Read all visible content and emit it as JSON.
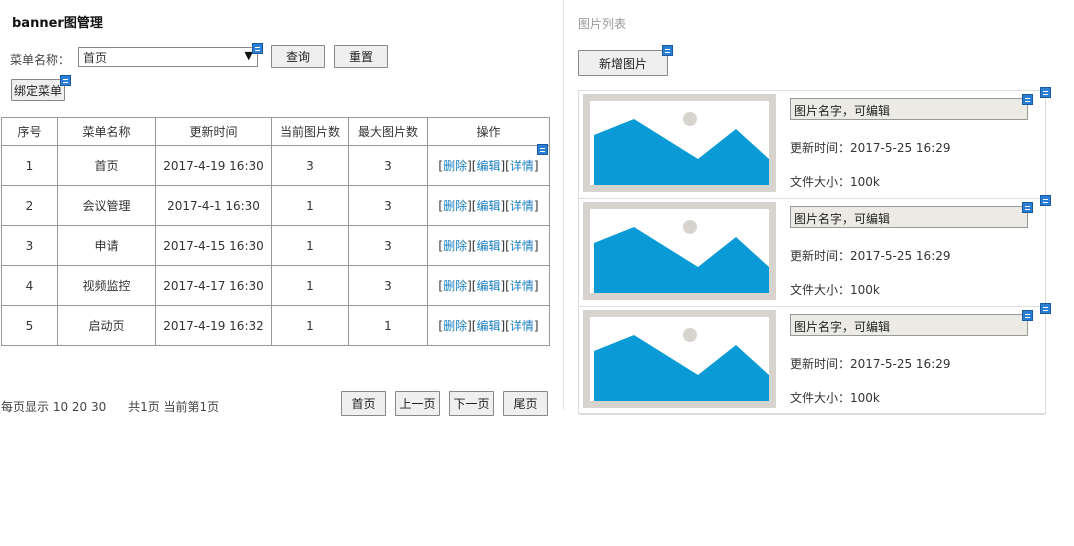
{
  "page_title": "banner图管理",
  "filter": {
    "label": "菜单名称：",
    "selected": "首页",
    "query_button": "查询",
    "reset_button": "重置",
    "bind_button": "绑定菜单"
  },
  "table": {
    "headers": [
      "序号",
      "菜单名称",
      "更新时间",
      "当前图片数",
      "最大图片数",
      "操作"
    ],
    "rows": [
      {
        "idx": "1",
        "name": "首页",
        "time": "2017-4-19 16:30",
        "current": "3",
        "max": "3"
      },
      {
        "idx": "2",
        "name": "会议管理",
        "time": "2017-4-1 16:30",
        "current": "1",
        "max": "3"
      },
      {
        "idx": "3",
        "name": "申请",
        "time": "2017-4-15 16:30",
        "current": "1",
        "max": "3"
      },
      {
        "idx": "4",
        "name": "视频监控",
        "time": "2017-4-17 16:30",
        "current": "1",
        "max": "3"
      },
      {
        "idx": "5",
        "name": "启动页",
        "time": "2017-4-19 16:32",
        "current": "1",
        "max": "1"
      }
    ],
    "ops": {
      "open": "[",
      "delete": "删除",
      "sep": "][",
      "edit": "编辑",
      "detail": "详情",
      "close": "]"
    }
  },
  "pager": {
    "page_size_label": "每页显示 10 20 30",
    "status": "共1页 当前第1页",
    "first": "首页",
    "prev": "上一页",
    "next": "下一页",
    "last": "尾页"
  },
  "right": {
    "title": "图片列表",
    "add_button": "新增图片",
    "items": [
      {
        "name": "图片名字，可编辑",
        "updated": "更新时间：2017-5-25 16:29",
        "size": "文件大小：100k"
      },
      {
        "name": "图片名字，可编辑",
        "updated": "更新时间：2017-5-25 16:29",
        "size": "文件大小：100k"
      },
      {
        "name": "图片名字，可编辑",
        "updated": "更新时间：2017-5-25 16:29",
        "size": "文件大小：100k"
      }
    ]
  },
  "colors": {
    "link": "#1a7fc4",
    "thumb_blue": "#0a9ad6",
    "edit_icon": "#2a7fd4"
  }
}
